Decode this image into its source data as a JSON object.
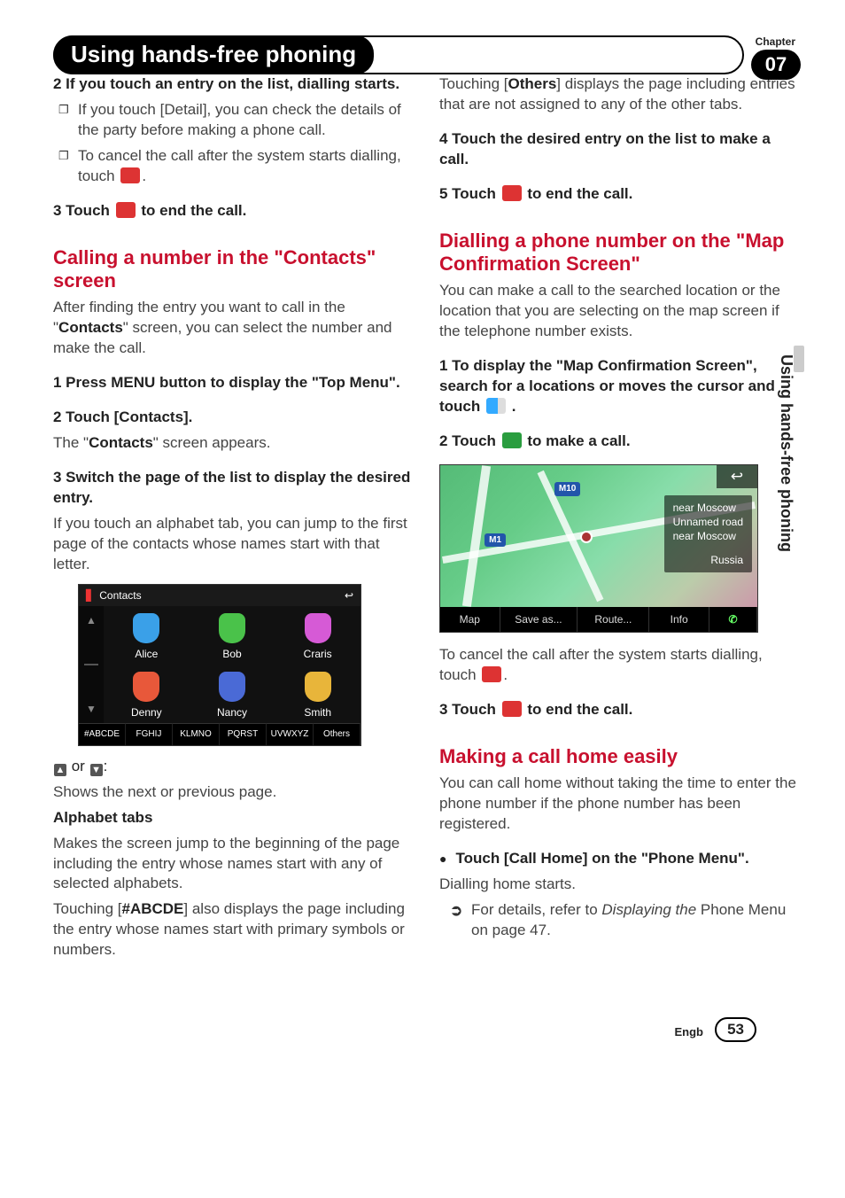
{
  "chapter": {
    "label": "Chapter",
    "number": "07"
  },
  "title": "Using hands-free phoning",
  "sideText": "Using hands-free phoning",
  "footer": {
    "lang": "Engb",
    "page": "53"
  },
  "icons": {
    "endcall": "end-call-icon",
    "makecall": "make-call-icon",
    "wflag": "flag-list-icon",
    "back": "↩",
    "up": "▲",
    "down": "▼"
  },
  "left": {
    "step2": "2   If you touch an entry on the list, dialling starts.",
    "note2a_pre": "If you touch [",
    "note2a_bold": "Detail",
    "note2a_post": "], you can check the details of the party before making a phone call.",
    "note2b_pre": "To cancel the call after the system starts dialling, touch ",
    "note2b_post": ".",
    "step3_pre": "3   Touch ",
    "step3_post": " to end the call.",
    "h_calling": "Calling a number in the \"Contacts\" screen",
    "calling_body_pre": "After finding the entry you want to call in the \"",
    "calling_body_bold": "Contacts",
    "calling_body_post": "\" screen, you can select the number and make the call.",
    "c_step1": "1   Press MENU button to display the \"Top Menu\".",
    "c_step2": "2   Touch [Contacts].",
    "c_step2_body_pre": "The \"",
    "c_step2_body_bold": "Contacts",
    "c_step2_body_post": "\" screen appears.",
    "c_step3": "3   Switch the page of the list to display the desired entry.",
    "c_step3_body": "If you touch an alphabet tab, you can jump to the first page of the contacts whose names start with that letter.",
    "arrows_line_mid": " or ",
    "arrows_line_end": ":",
    "arrows_body": "Shows the next or previous page.",
    "alpha_label": "Alphabet tabs",
    "alpha_body": "Makes the screen jump to the beginning of the page including the entry whose names start with any of selected alphabets.",
    "alpha_body2_pre": "Touching [",
    "alpha_body2_bold": "#ABCDE",
    "alpha_body2_post": "] also displays the page including the entry whose names start with primary symbols or numbers."
  },
  "right": {
    "others_pre": "Touching [",
    "others_bold": "Others",
    "others_post": "] displays the page including entries that are not assigned to any of the other tabs.",
    "r_step4": "4   Touch the desired entry on the list to make a call.",
    "r_step5_pre": "5   Touch ",
    "r_step5_post": " to end the call.",
    "h_dial": "Dialling a phone number on the \"Map Confirmation Screen\"",
    "dial_body": "You can make a call to the searched location or the location that you are selecting on the map screen if the telephone number exists.",
    "d_step1_pre": "1   To display the \"Map Confirmation Screen\", search for a locations or moves the cursor and touch ",
    "d_step1_post": " .",
    "d_step2_pre": "2   Touch ",
    "d_step2_post": " to make a call.",
    "cancel_pre": "To cancel the call after the system starts dialling, touch ",
    "cancel_post": ".",
    "d_step3_pre": "3   Touch ",
    "d_step3_post": " to end the call.",
    "h_home": "Making a call home easily",
    "home_body": "You can call home without taking the time to enter the phone number if the phone number has been registered.",
    "home_step": "Touch [Call Home] on the \"Phone Menu\".",
    "home_step_body": "Dialling home starts.",
    "home_ref_pre": "For details, refer to ",
    "home_ref_italic": "Displaying the",
    "home_ref_bold": " Phone Menu",
    "home_ref_post": " on page 47."
  },
  "contactsScreen": {
    "title": "Contacts",
    "names": [
      "Alice",
      "Bob",
      "Craris",
      "Denny",
      "Nancy",
      "Smith"
    ],
    "colors": [
      "#3aa0e8",
      "#4ac24a",
      "#d65ad6",
      "#e8583a",
      "#4a6ad6",
      "#e8b53a"
    ],
    "tabs": [
      "#ABCDE",
      "FGHIJ",
      "KLMNO",
      "PQRST",
      "UVWXYZ",
      "Others"
    ]
  },
  "mapScreen": {
    "m10": "M10",
    "m1": "M1",
    "info1": "near Moscow",
    "info2": "Unnamed road",
    "info3": "near Moscow",
    "info4": "Russia",
    "tabs": [
      "Map",
      "Save as...",
      "Route...",
      "Info"
    ],
    "callGlyph": "✆"
  }
}
